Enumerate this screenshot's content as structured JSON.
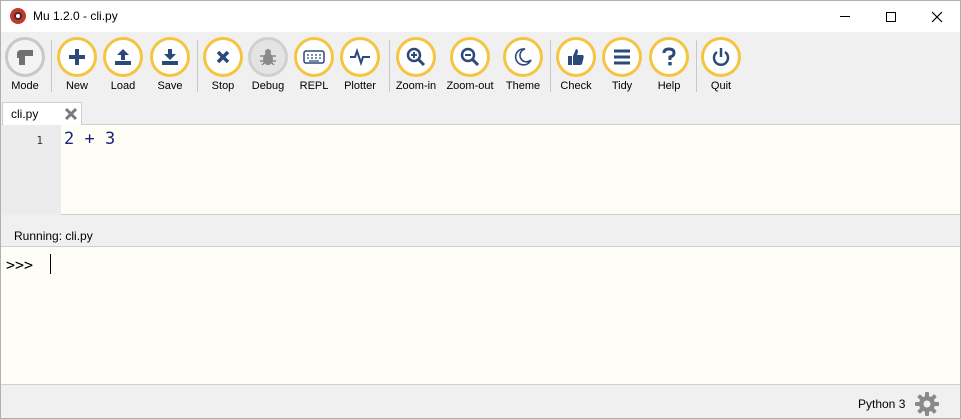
{
  "window": {
    "title": "Mu 1.2.0 - cli.py"
  },
  "toolbar": {
    "buttons": [
      {
        "label": "Mode",
        "icon": "mode-icon"
      },
      {
        "label": "New",
        "icon": "plus-icon"
      },
      {
        "label": "Load",
        "icon": "upload-icon"
      },
      {
        "label": "Save",
        "icon": "download-icon"
      },
      {
        "label": "Stop",
        "icon": "close-icon"
      },
      {
        "label": "Debug",
        "icon": "bug-icon"
      },
      {
        "label": "REPL",
        "icon": "keyboard-icon"
      },
      {
        "label": "Plotter",
        "icon": "pulse-icon"
      },
      {
        "label": "Zoom-in",
        "icon": "zoom-in-icon"
      },
      {
        "label": "Zoom-out",
        "icon": "zoom-out-icon"
      },
      {
        "label": "Theme",
        "icon": "moon-icon"
      },
      {
        "label": "Check",
        "icon": "thumbs-up-icon"
      },
      {
        "label": "Tidy",
        "icon": "lines-icon"
      },
      {
        "label": "Help",
        "icon": "question-icon"
      },
      {
        "label": "Quit",
        "icon": "power-icon"
      }
    ]
  },
  "tabs": [
    {
      "label": "cli.py"
    }
  ],
  "editor": {
    "line_number": "1",
    "code": "2 + 3"
  },
  "runner": {
    "label": "Running: cli.py"
  },
  "repl": {
    "prompt": ">>>"
  },
  "status": {
    "mode": "Python 3"
  },
  "colors": {
    "button_ring": "#f5c542",
    "icon": "#2b4a7a",
    "editor_bg": "#fefef7",
    "code_text": "#1a237e"
  }
}
